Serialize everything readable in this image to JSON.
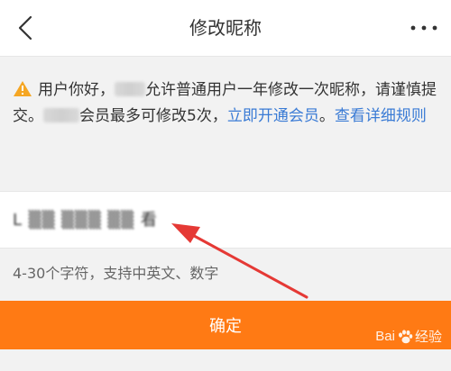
{
  "header": {
    "title": "修改昵称",
    "back_icon": "chevron-left-icon",
    "more_icon": "more-dots-icon"
  },
  "notice": {
    "icon": "warning-icon",
    "prefix": "用户你好，",
    "part1": "允许普通用户一年修改一次昵称，请谨慎提交。",
    "part2": "会员最多可修改5次，",
    "open_vip_link": "立即开通会员",
    "separator": "。",
    "rules_link": "查看详细规则",
    "link_color": "#3a7bd5"
  },
  "nickname": {
    "value": "L ▒▒ ▒▒▒ ▒▒ 看"
  },
  "hint": {
    "text": "4-30个字符，支持中英文、数字"
  },
  "confirm": {
    "label": "确定",
    "color": "#ff7a14"
  },
  "watermark": {
    "text_left": "Bai",
    "text_right": "经验"
  },
  "annotation": {
    "arrow_color": "#e53935"
  }
}
